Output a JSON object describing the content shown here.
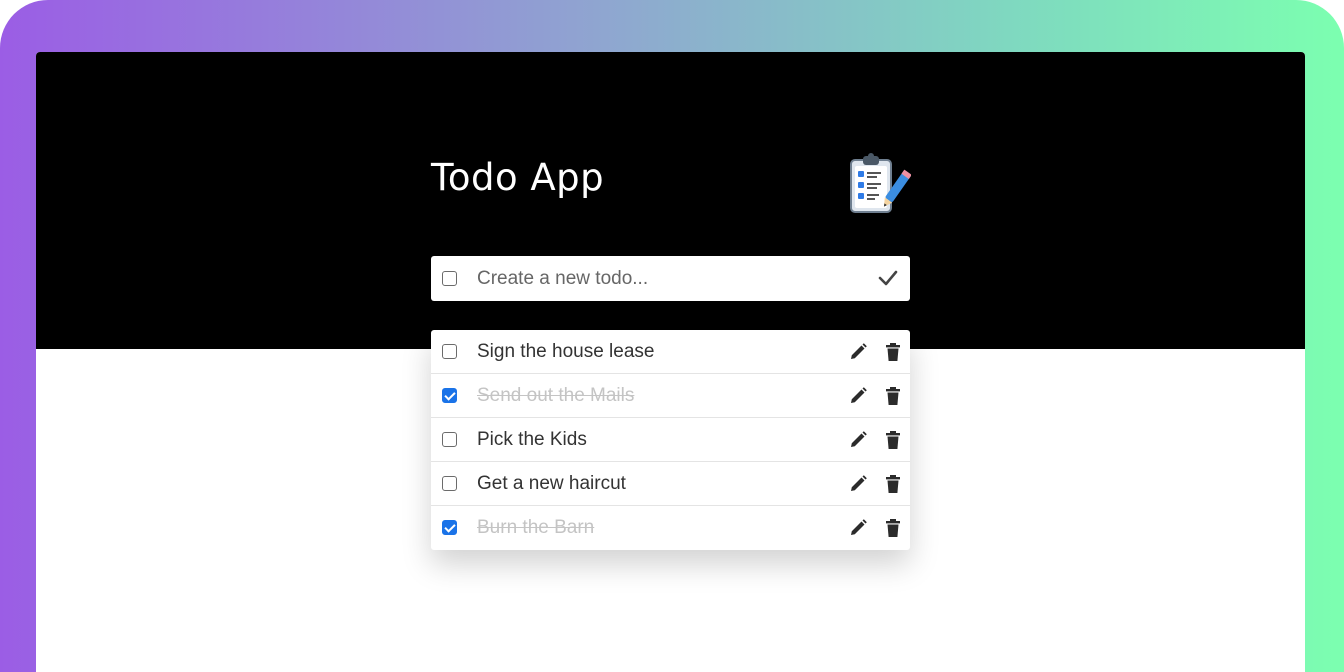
{
  "app": {
    "title": "Todo App",
    "logo_icon": "clipboard-checklist-icon"
  },
  "new_todo": {
    "placeholder": "Create a new todo...",
    "value": "",
    "checked": false,
    "submit_icon": "check-icon"
  },
  "todos": [
    {
      "text": "Sign the house lease",
      "completed": false
    },
    {
      "text": "Send out the Mails",
      "completed": true
    },
    {
      "text": "Pick the Kids",
      "completed": false
    },
    {
      "text": "Get a new haircut",
      "completed": false
    },
    {
      "text": "Burn the Barn",
      "completed": true
    }
  ],
  "row_actions": {
    "edit_icon": "pencil-icon",
    "delete_icon": "trash-icon"
  },
  "colors": {
    "header_background": "#000000",
    "checkbox_checked": "#1a73e8",
    "completed_text": "#c4c4c4",
    "frame_gradient_start": "#9b5de5",
    "frame_gradient_end": "#7cffb0"
  }
}
